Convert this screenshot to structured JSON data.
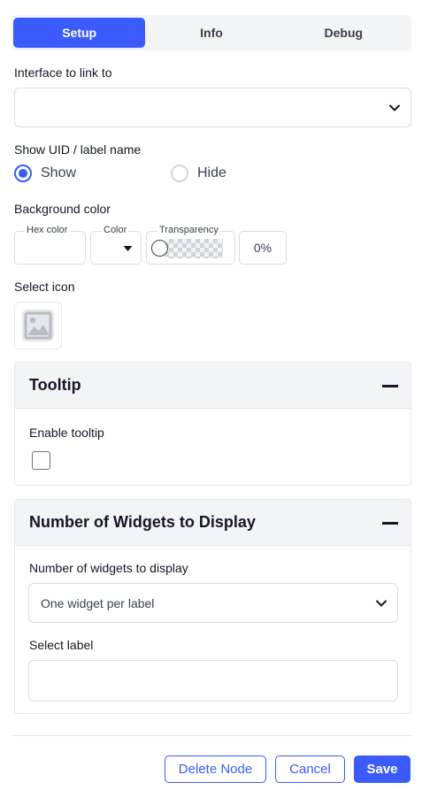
{
  "tabs": [
    {
      "label": "Setup",
      "active": true
    },
    {
      "label": "Info",
      "active": false
    },
    {
      "label": "Debug",
      "active": false
    }
  ],
  "interface": {
    "label": "Interface to link to",
    "value": ""
  },
  "uid_label": {
    "label": "Show UID / label name",
    "options": [
      {
        "label": "Show",
        "checked": true
      },
      {
        "label": "Hide",
        "checked": false
      }
    ]
  },
  "background": {
    "label": "Background color",
    "hex_caption": "Hex color",
    "hex_value": "",
    "color_caption": "Color",
    "transparency_caption": "Transparency",
    "transparency_value": "0%"
  },
  "select_icon": {
    "label": "Select icon",
    "icon": "image-placeholder-icon"
  },
  "tooltip_panel": {
    "title": "Tooltip",
    "enable_label": "Enable tooltip",
    "enabled": false
  },
  "widgets_panel": {
    "title": "Number of Widgets to Display",
    "count_label": "Number of widgets to display",
    "count_value": "One widget per label",
    "select_label": "Select label",
    "select_value": ""
  },
  "footer": {
    "delete_label": "Delete Node",
    "cancel_label": "Cancel",
    "save_label": "Save"
  },
  "colors": {
    "accent": "#3b5bfd",
    "border": "#d9dde3",
    "panel_header": "#f3f4f6"
  }
}
